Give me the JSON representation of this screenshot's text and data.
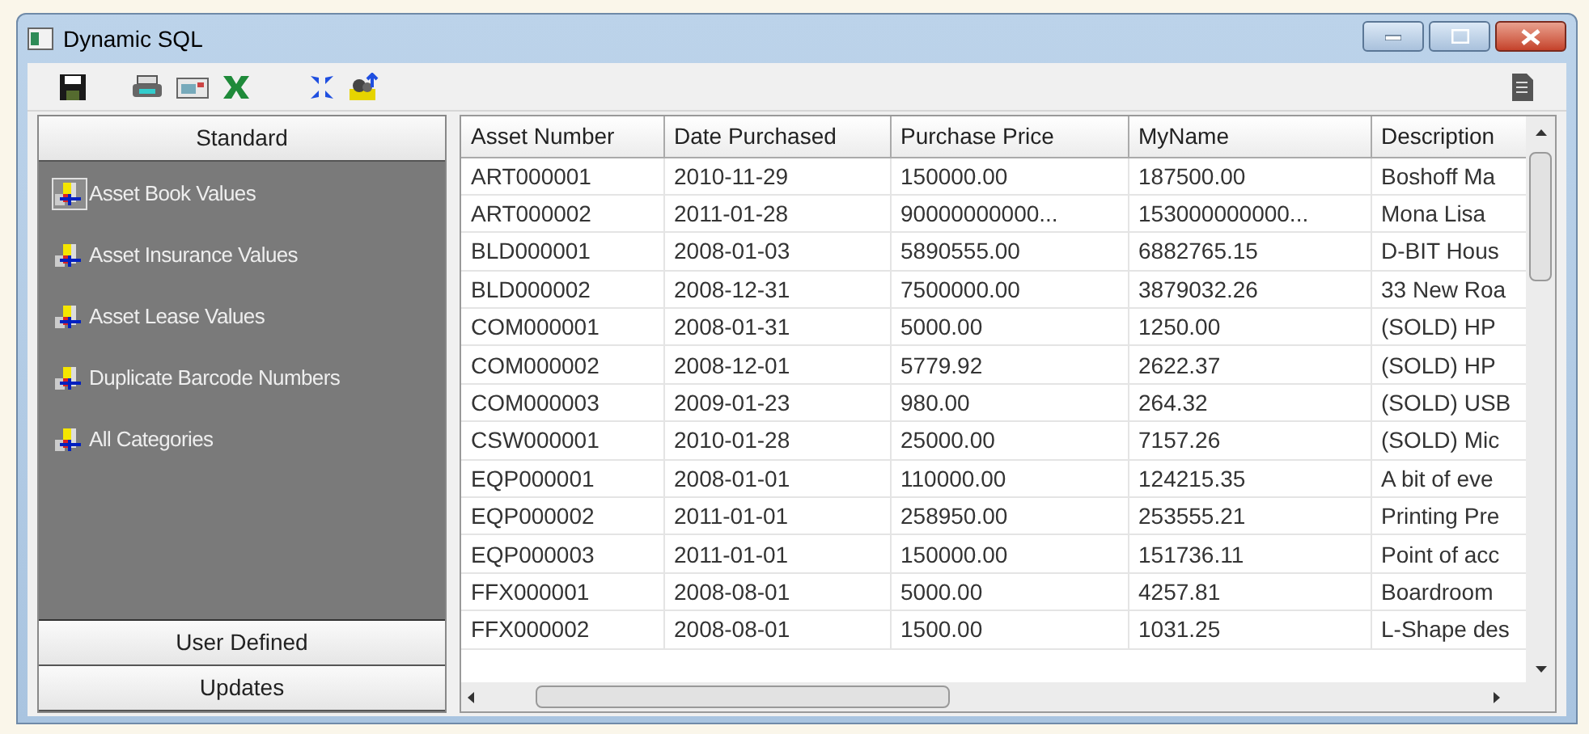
{
  "window": {
    "title": "Dynamic SQL"
  },
  "sidebar": {
    "sections": [
      {
        "label": "Standard",
        "expanded": true,
        "items": [
          {
            "label": "Asset Book Values",
            "selected": true
          },
          {
            "label": "Asset Insurance Values",
            "selected": false
          },
          {
            "label": "Asset Lease Values",
            "selected": false
          },
          {
            "label": "Duplicate Barcode Numbers",
            "selected": false
          },
          {
            "label": "All Categories",
            "selected": false
          }
        ]
      },
      {
        "label": "User Defined",
        "expanded": false
      },
      {
        "label": "Updates",
        "expanded": false
      }
    ]
  },
  "table": {
    "columns": [
      "Asset Number",
      "Date Purchased",
      "Purchase Price",
      "MyName",
      "Description"
    ],
    "rows": [
      [
        "ART000001",
        "2010-11-29",
        "150000.00",
        "187500.00",
        "Boshoff Ma"
      ],
      [
        "ART000002",
        "2011-01-28",
        "90000000000...",
        "153000000000...",
        "Mona Lisa"
      ],
      [
        "BLD000001",
        "2008-01-03",
        "5890555.00",
        "6882765.15",
        "D-BIT Hous"
      ],
      [
        "BLD000002",
        "2008-12-31",
        "7500000.00",
        "3879032.26",
        "33 New Roa"
      ],
      [
        "COM000001",
        "2008-01-31",
        "5000.00",
        "1250.00",
        "(SOLD) HP"
      ],
      [
        "COM000002",
        "2008-12-01",
        "5779.92",
        "2622.37",
        "(SOLD) HP"
      ],
      [
        "COM000003",
        "2009-01-23",
        "980.00",
        "264.32",
        "(SOLD) USB"
      ],
      [
        "CSW000001",
        "2010-01-28",
        "25000.00",
        "7157.26",
        "(SOLD) Mic"
      ],
      [
        "EQP000001",
        "2008-01-01",
        "110000.00",
        "124215.35",
        "A bit of eve"
      ],
      [
        "EQP000002",
        "2011-01-01",
        "258950.00",
        "253555.21",
        "Printing Pre"
      ],
      [
        "EQP000003",
        "2011-01-01",
        "150000.00",
        "151736.11",
        "Point of acc"
      ],
      [
        "FFX000001",
        "2008-08-01",
        "5000.00",
        "4257.81",
        "Boardroom"
      ],
      [
        "FFX000002",
        "2008-08-01",
        "1500.00",
        "1031.25",
        "L-Shape des"
      ]
    ]
  }
}
